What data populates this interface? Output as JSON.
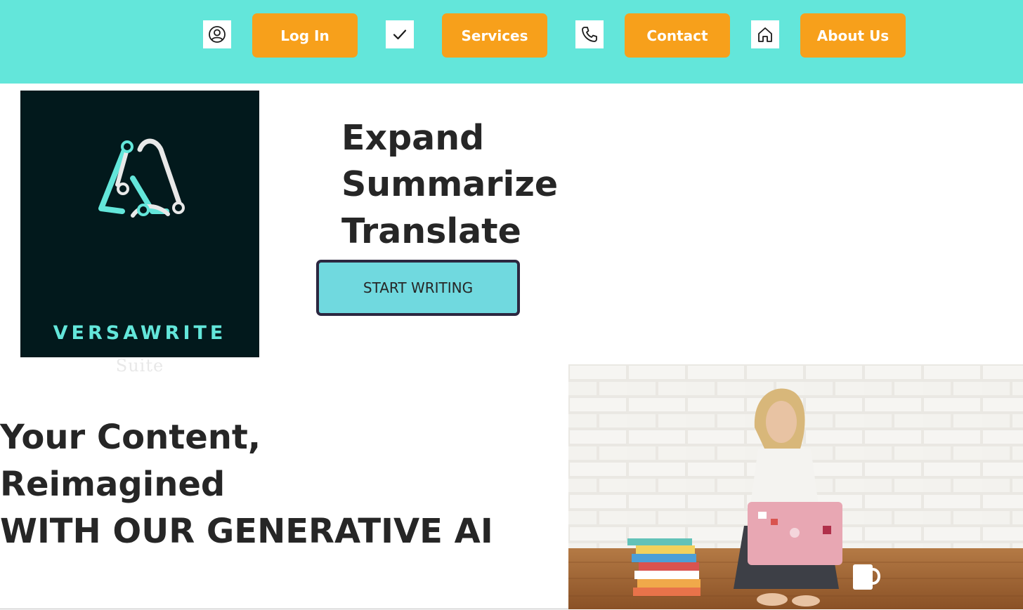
{
  "nav": {
    "icons": [
      "user-circle-icon",
      "check-icon",
      "phone-icon",
      "home-icon"
    ],
    "buttons": [
      "Log In",
      "Services",
      "Contact",
      "About Us"
    ]
  },
  "logo": {
    "name": "VERSAWRITE",
    "subtitle": "Suite"
  },
  "hero": {
    "words": [
      "Expand",
      "Summarize",
      "Translate"
    ],
    "cta_label": "START WRITING"
  },
  "tagline": {
    "line1": "Your Content,",
    "line2": "Reimagined",
    "line3": "WITH OUR GENERATIVE AI"
  },
  "colors": {
    "topbar": "#63e6da",
    "nav_button": "#f7a01b",
    "cta_background": "#70d9df",
    "cta_border": "#2c2740",
    "logo_background": "#02191c",
    "logo_accent": "#63e6da",
    "heading_text": "#262626"
  }
}
